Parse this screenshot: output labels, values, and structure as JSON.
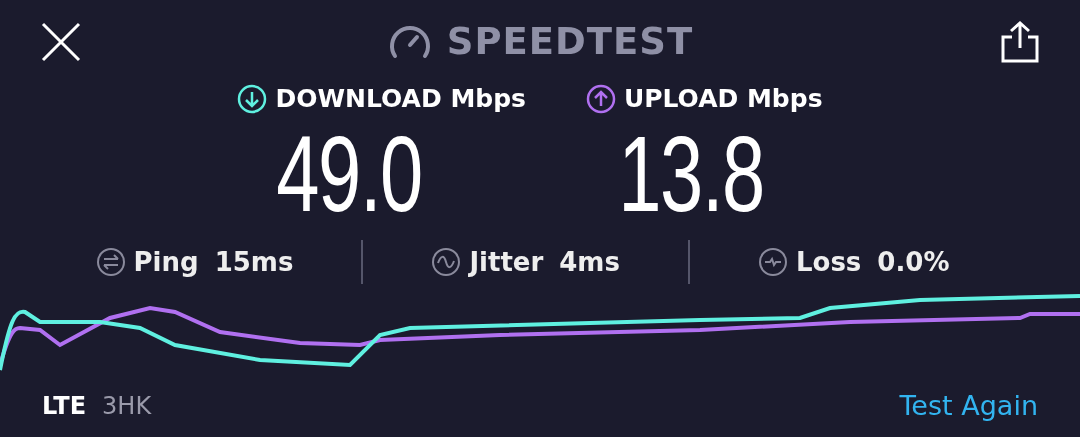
{
  "header": {
    "title": "SPEEDTEST"
  },
  "results": [
    {
      "kind": "download",
      "label": "DOWNLOAD Mbps",
      "value": "49.0"
    },
    {
      "kind": "upload",
      "label": "UPLOAD Mbps",
      "value": "13.8"
    }
  ],
  "stats": [
    {
      "kind": "ping",
      "label": "Ping",
      "value": "15ms"
    },
    {
      "kind": "jitter",
      "label": "Jitter",
      "value": "4ms"
    },
    {
      "kind": "loss",
      "label": "Loss",
      "value": "0.0%"
    }
  ],
  "footer": {
    "network_type": "LTE",
    "carrier": "3HK",
    "action": "Test Again"
  }
}
